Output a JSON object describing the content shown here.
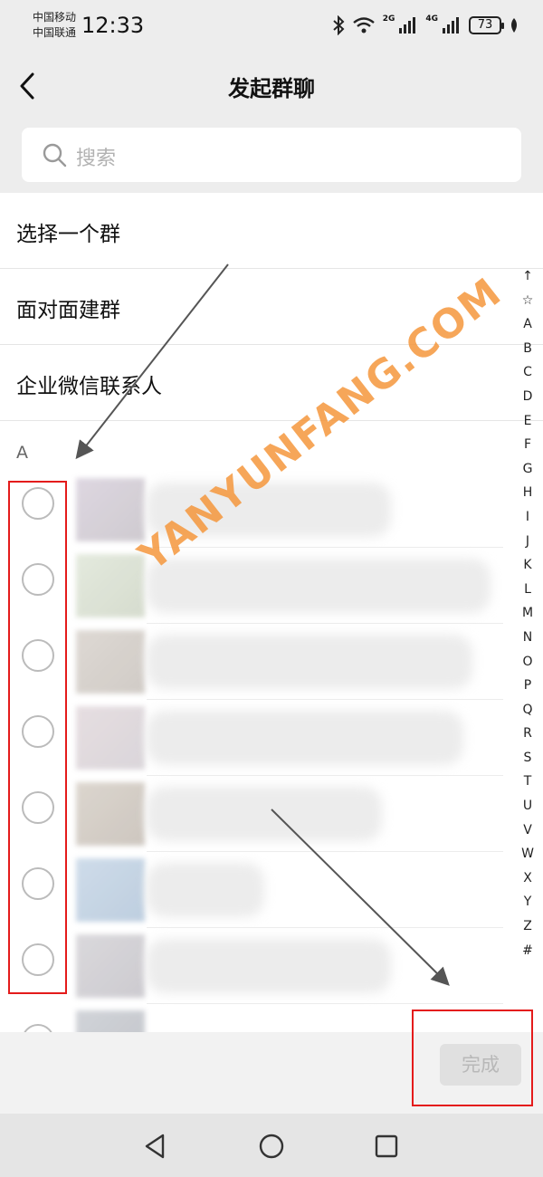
{
  "status_bar": {
    "carrier_1": "中国移动",
    "carrier_2": "中国联通",
    "time": "12:33",
    "network_1": "2G",
    "network_2": "4G",
    "battery": "73"
  },
  "header": {
    "title": "发起群聊",
    "back_icon": "chevron-left-icon"
  },
  "search": {
    "placeholder": "搜索",
    "icon": "search-icon"
  },
  "menu": [
    {
      "label": "选择一个群"
    },
    {
      "label": "面对面建群"
    },
    {
      "label": "企业微信联系人"
    }
  ],
  "section_header": "A",
  "contacts_count_visible": 7,
  "alphabet_index": [
    "↑",
    "☆",
    "A",
    "B",
    "C",
    "D",
    "E",
    "F",
    "G",
    "H",
    "I",
    "J",
    "K",
    "L",
    "M",
    "N",
    "O",
    "P",
    "Q",
    "R",
    "S",
    "T",
    "U",
    "V",
    "W",
    "X",
    "Y",
    "Z",
    "#"
  ],
  "footer": {
    "done_label": "完成"
  },
  "watermark": "YANYUNFANG.COM",
  "colors": {
    "background": "#ededed",
    "highlight_box": "#e41b1b",
    "watermark": "#f5963c",
    "done_disabled": "#b8b8b8"
  }
}
